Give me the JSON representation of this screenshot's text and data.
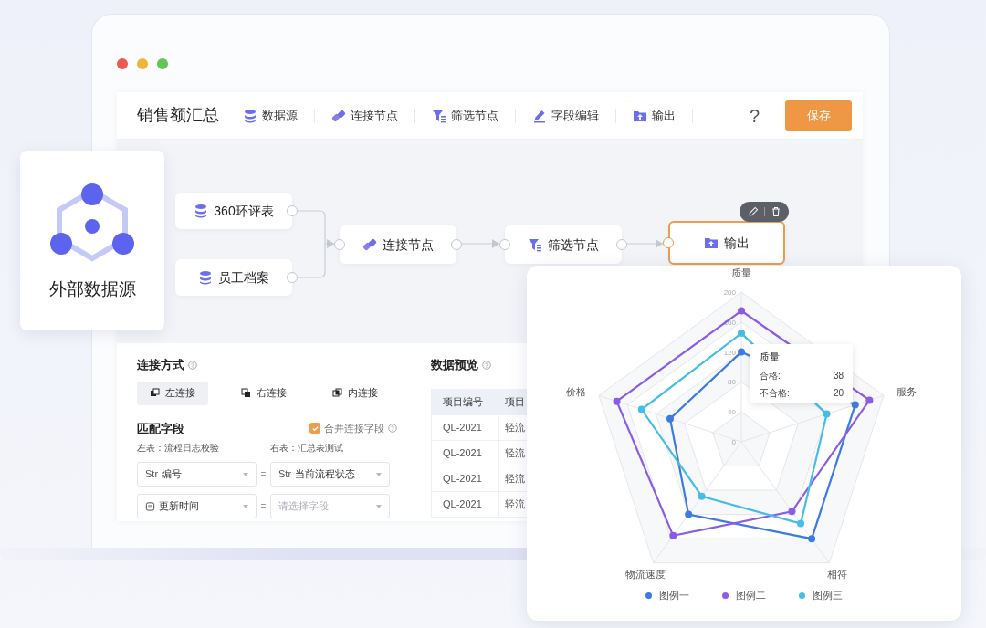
{
  "toolbar": {
    "title": "销售额汇总",
    "items": [
      {
        "kind": "database",
        "label": "数据源"
      },
      {
        "kind": "link",
        "label": "连接节点"
      },
      {
        "kind": "filter",
        "label": "筛选节点"
      },
      {
        "kind": "edit",
        "label": "字段编辑"
      },
      {
        "kind": "output",
        "label": "输出"
      }
    ],
    "help": "?",
    "save_button": "保存"
  },
  "flow": {
    "nodes": [
      {
        "kind": "database",
        "label": "360环评表",
        "selected": false
      },
      {
        "kind": "database",
        "label": "员工档案",
        "selected": false
      },
      {
        "kind": "link",
        "label": "连接节点",
        "selected": false
      },
      {
        "kind": "filter",
        "label": "筛选节点",
        "selected": false
      },
      {
        "kind": "output",
        "label": "输出",
        "selected": true
      }
    ]
  },
  "external_source_card": {
    "label": "外部数据源"
  },
  "join_panel": {
    "title": "连接方式",
    "join_types": [
      {
        "kind": "left",
        "label": "左连接",
        "selected": true
      },
      {
        "kind": "right",
        "label": "右连接",
        "selected": false
      },
      {
        "kind": "inner",
        "label": "内连接",
        "selected": false
      }
    ],
    "match_title": "匹配字段",
    "merge_checkbox": {
      "label": "合并连接字段",
      "checked": true
    },
    "left_table": "左表：流程日志校验",
    "right_table": "右表：汇总表测试",
    "pairs": [
      {
        "left": {
          "kind": "text",
          "type": "Str",
          "value": "编号"
        },
        "operator": "=",
        "right": {
          "kind": "text",
          "type": "Str",
          "value": "当前流程状态"
        }
      },
      {
        "left": {
          "kind": "date",
          "value": "更新时间"
        },
        "operator": "=",
        "right": {
          "kind": "empty",
          "placeholder": "请选择字段"
        }
      }
    ]
  },
  "preview": {
    "title": "数据预览",
    "columns": [
      "项目编号",
      "项目"
    ],
    "rows": [
      [
        "QL-2021",
        "轻流"
      ],
      [
        "QL-2021",
        "轻流"
      ],
      [
        "QL-2021",
        "轻流"
      ],
      [
        "QL-2021",
        "轻流"
      ]
    ]
  },
  "chart": {
    "chart_data": {
      "type": "radar",
      "categories": [
        "质量",
        "服务",
        "相符",
        "物流速度",
        "价格"
      ],
      "ylim": [
        0,
        200
      ],
      "yticks": [
        0,
        40,
        80,
        120,
        160,
        200
      ],
      "series": [
        {
          "name": "图例一",
          "color": "#3d7be0",
          "values": [
            120,
            160,
            160,
            120,
            100
          ]
        },
        {
          "name": "图例二",
          "color": "#8a5ce8",
          "values": [
            175,
            180,
            115,
            155,
            175
          ]
        },
        {
          "name": "图例三",
          "color": "#45bde6",
          "values": [
            145,
            120,
            135,
            90,
            140
          ]
        }
      ]
    },
    "tooltip": {
      "title": "质量",
      "rows": [
        {
          "label": "合格:",
          "value": "38"
        },
        {
          "label": "不合格:",
          "value": "20"
        }
      ]
    }
  }
}
